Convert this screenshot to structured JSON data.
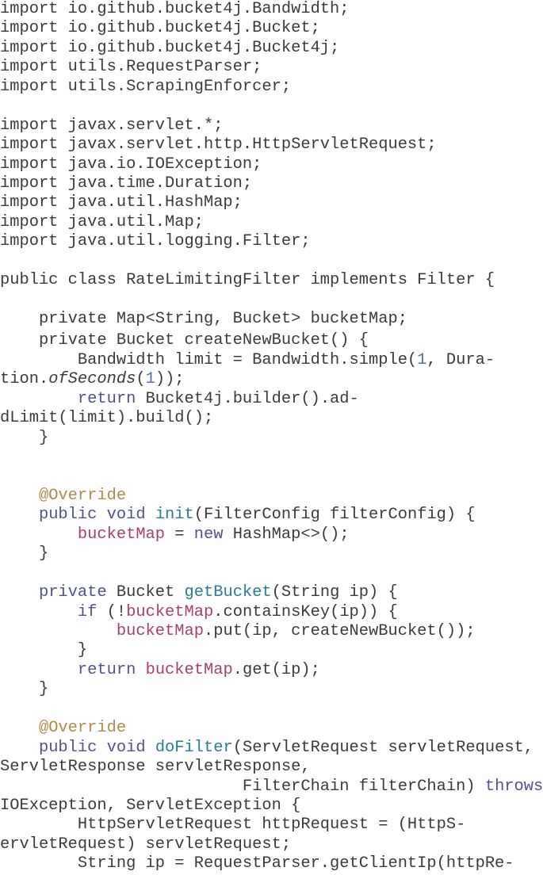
{
  "document": {
    "type": "code-listing",
    "language": "java",
    "colors": {
      "text": "#3b3b3b",
      "keyword": "#4f5488",
      "method": "#2c7b90",
      "field": "#a3426f",
      "annotation": "#b08b4c",
      "number": "#5a6fa8",
      "background": "#ffffff"
    },
    "lines": [
      [
        {
          "t": "pl",
          "s": "import io.github.bucket4j.Bandwidth;"
        }
      ],
      [
        {
          "t": "pl",
          "s": "import io.github.bucket4j.Bucket;"
        }
      ],
      [
        {
          "t": "pl",
          "s": "import io.github.bucket4j.Bucket4j;"
        }
      ],
      [
        {
          "t": "pl",
          "s": "import utils.RequestParser;"
        }
      ],
      [
        {
          "t": "pl",
          "s": "import utils.ScrapingEnforcer;"
        }
      ],
      [],
      [
        {
          "t": "pl",
          "s": "import javax.servlet.*;"
        }
      ],
      [
        {
          "t": "pl",
          "s": "import javax.servlet.http.HttpServletRequest;"
        }
      ],
      [
        {
          "t": "pl",
          "s": "import java.io.IOException;"
        }
      ],
      [
        {
          "t": "pl",
          "s": "import java.time.Duration;"
        }
      ],
      [
        {
          "t": "pl",
          "s": "import java.util.HashMap;"
        }
      ],
      [
        {
          "t": "pl",
          "s": "import java.util.Map;"
        }
      ],
      [
        {
          "t": "pl",
          "s": "import java.util.logging.Filter;"
        }
      ],
      [],
      [
        {
          "t": "pl",
          "s": "public class RateLimitingFilter implements Filter {"
        }
      ],
      [],
      [
        {
          "t": "pl",
          "s": "    private Map<String, Bucket> bucketMap;"
        }
      ],
      [
        {
          "t": "pl",
          "s": "    private Bucket createNewBucket() {",
          "gap": true
        }
      ],
      [
        {
          "t": "pl",
          "s": "        Bandwidth limit = Bandwidth.simple("
        },
        {
          "t": "num",
          "s": "1"
        },
        {
          "t": "pl",
          "s": ", Dura-"
        }
      ],
      [
        {
          "t": "pl",
          "s": "tion."
        },
        {
          "t": "it",
          "s": "ofSeconds"
        },
        {
          "t": "pl",
          "s": "("
        },
        {
          "t": "num",
          "s": "1"
        },
        {
          "t": "pl",
          "s": "));"
        }
      ],
      [
        {
          "t": "pl",
          "s": "        "
        },
        {
          "t": "kw",
          "s": "return"
        },
        {
          "t": "pl",
          "s": " Bucket4j.builder().ad-"
        }
      ],
      [
        {
          "t": "pl",
          "s": "dLimit(limit).build();"
        }
      ],
      [
        {
          "t": "pl",
          "s": "    }"
        }
      ],
      [],
      [],
      [
        {
          "t": "pl",
          "s": "    "
        },
        {
          "t": "ann",
          "s": "@Override"
        }
      ],
      [
        {
          "t": "pl",
          "s": "    "
        },
        {
          "t": "kw",
          "s": "public void"
        },
        {
          "t": "pl",
          "s": " "
        },
        {
          "t": "fn",
          "s": "init"
        },
        {
          "t": "pl",
          "s": "(FilterConfig filterConfig) {"
        }
      ],
      [
        {
          "t": "pl",
          "s": "        "
        },
        {
          "t": "fld",
          "s": "bucketMap"
        },
        {
          "t": "pl",
          "s": " = "
        },
        {
          "t": "kw",
          "s": "new"
        },
        {
          "t": "pl",
          "s": " HashMap<>();"
        }
      ],
      [
        {
          "t": "pl",
          "s": "    }"
        }
      ],
      [],
      [
        {
          "t": "pl",
          "s": "    "
        },
        {
          "t": "kw",
          "s": "private"
        },
        {
          "t": "pl",
          "s": " Bucket "
        },
        {
          "t": "fn",
          "s": "getBucket"
        },
        {
          "t": "pl",
          "s": "(String ip) {"
        }
      ],
      [
        {
          "t": "pl",
          "s": "        "
        },
        {
          "t": "kw",
          "s": "if"
        },
        {
          "t": "pl",
          "s": " (!"
        },
        {
          "t": "fld",
          "s": "bucketMap"
        },
        {
          "t": "pl",
          "s": ".containsKey(ip)) {"
        }
      ],
      [
        {
          "t": "pl",
          "s": "            "
        },
        {
          "t": "fld",
          "s": "bucketMap"
        },
        {
          "t": "pl",
          "s": ".put(ip, createNewBucket());"
        }
      ],
      [
        {
          "t": "pl",
          "s": "        }"
        }
      ],
      [
        {
          "t": "pl",
          "s": "        "
        },
        {
          "t": "kw",
          "s": "return"
        },
        {
          "t": "pl",
          "s": " "
        },
        {
          "t": "fld",
          "s": "bucketMap"
        },
        {
          "t": "pl",
          "s": ".get(ip);"
        }
      ],
      [
        {
          "t": "pl",
          "s": "    }"
        }
      ],
      [],
      [
        {
          "t": "pl",
          "s": "    "
        },
        {
          "t": "ann",
          "s": "@Override"
        }
      ],
      [
        {
          "t": "pl",
          "s": "    "
        },
        {
          "t": "kw",
          "s": "public void"
        },
        {
          "t": "pl",
          "s": " "
        },
        {
          "t": "fn",
          "s": "doFilter"
        },
        {
          "t": "pl",
          "s": "(ServletRequest servletRequest,"
        }
      ],
      [
        {
          "t": "pl",
          "s": "ServletResponse servletResponse,"
        }
      ],
      [
        {
          "t": "pl",
          "s": "                         FilterChain filterChain) "
        },
        {
          "t": "kw",
          "s": "throws"
        }
      ],
      [
        {
          "t": "pl",
          "s": "IOException, ServletException {"
        }
      ],
      [
        {
          "t": "pl",
          "s": "        HttpServletRequest httpRequest = (HttpS-"
        }
      ],
      [
        {
          "t": "pl",
          "s": "ervletRequest) servletRequest;"
        }
      ],
      [
        {
          "t": "pl",
          "s": "        String ip = RequestParser.getClientIp(httpRe-"
        }
      ]
    ]
  }
}
